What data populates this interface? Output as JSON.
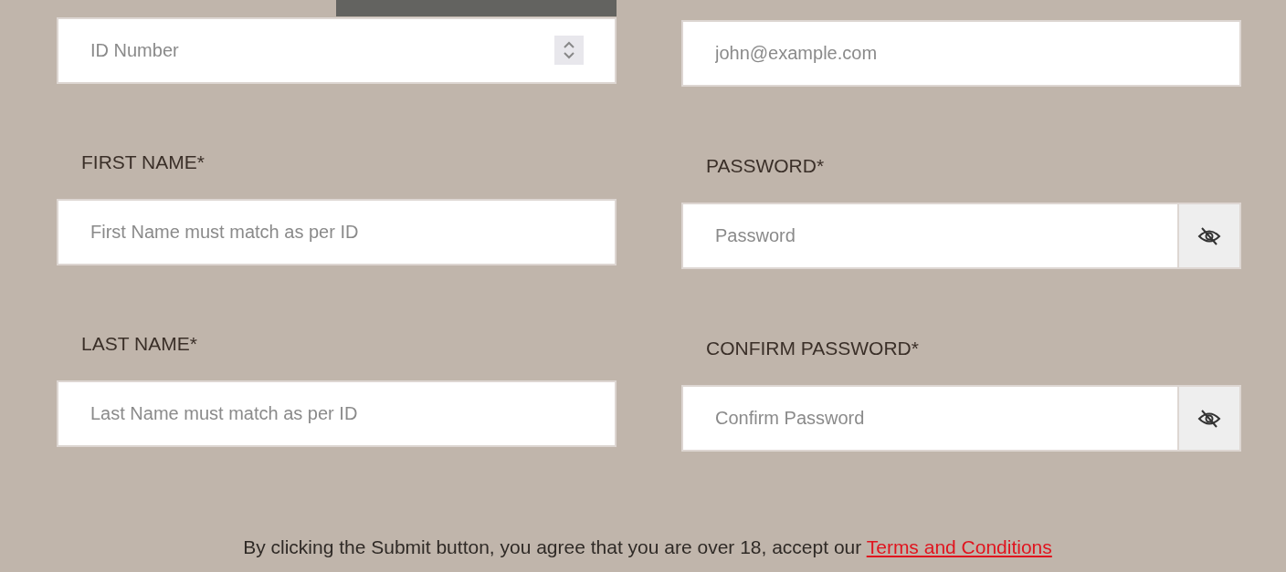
{
  "columns": [
    {
      "fields": [
        {
          "kind": "number",
          "placeholder": "ID Number"
        },
        {
          "kind": "text",
          "label": "FIRST NAME*",
          "placeholder": "First Name must match as per ID"
        },
        {
          "kind": "text",
          "label": "LAST NAME*",
          "placeholder": "Last Name must match as per ID"
        }
      ]
    },
    {
      "fields": [
        {
          "kind": "email",
          "placeholder": "john@example.com"
        },
        {
          "kind": "password",
          "label": "PASSWORD*",
          "placeholder": "Password"
        },
        {
          "kind": "password",
          "label": "CONFIRM PASSWORD*",
          "placeholder": "Confirm Password"
        }
      ]
    }
  ],
  "agreement": {
    "text": "By clicking the Submit button, you agree that you are over 18, accept our ",
    "link": "Terms and Conditions"
  }
}
